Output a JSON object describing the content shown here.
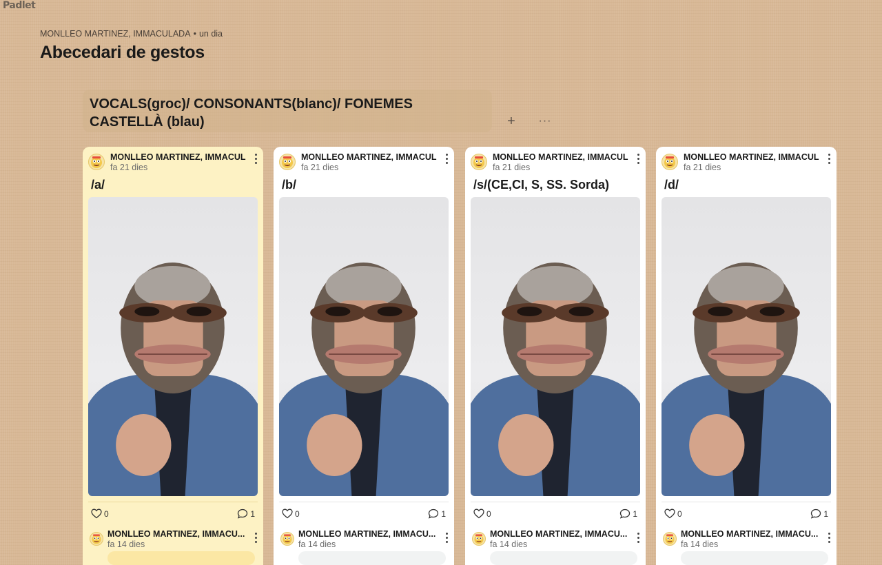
{
  "app": {
    "logo": "Padlet"
  },
  "board": {
    "author": "MONLLEO MARTINEZ, IMMACULADA",
    "separator": "•",
    "updated": "un dia",
    "title": "Abecedari de gestos"
  },
  "section": {
    "title_line1": "VOCALS(groc)/ CONSONANTS(blanc)/ FONEMES",
    "title_line2": "CASTELLÀ (blau)",
    "add_label": "+",
    "more_label": "···"
  },
  "colors": {
    "background": "#d8b896",
    "card_yellow": "#fdf2c4",
    "card_white": "#ffffff"
  },
  "cards": [
    {
      "author": "MONLLEO MARTINEZ, IMMACUL",
      "time": "fa 21 dies",
      "subject": "/a/",
      "likes": "0",
      "comments": "1",
      "comment": {
        "author": "MONLLEO MARTINEZ, IMMACU...",
        "time": "fa 14 dies"
      }
    },
    {
      "author": "MONLLEO MARTINEZ, IMMACUL",
      "time": "fa 21 dies",
      "subject": "/b/",
      "likes": "0",
      "comments": "1",
      "comment": {
        "author": "MONLLEO MARTINEZ, IMMACU...",
        "time": "fa 14 dies"
      }
    },
    {
      "author": "MONLLEO MARTINEZ, IMMACUL",
      "time": "fa 21 dies",
      "subject": "/s/(CE,CI, S, SS. Sorda)",
      "likes": "0",
      "comments": "1",
      "comment": {
        "author": "MONLLEO MARTINEZ, IMMACU...",
        "time": "fa 14 dies"
      }
    },
    {
      "author": "MONLLEO MARTINEZ, IMMACUL",
      "time": "fa 21 dies",
      "subject": "/d/",
      "likes": "0",
      "comments": "1",
      "comment": {
        "author": "MONLLEO MARTINEZ, IMMACU...",
        "time": "fa 14 dies"
      }
    }
  ]
}
